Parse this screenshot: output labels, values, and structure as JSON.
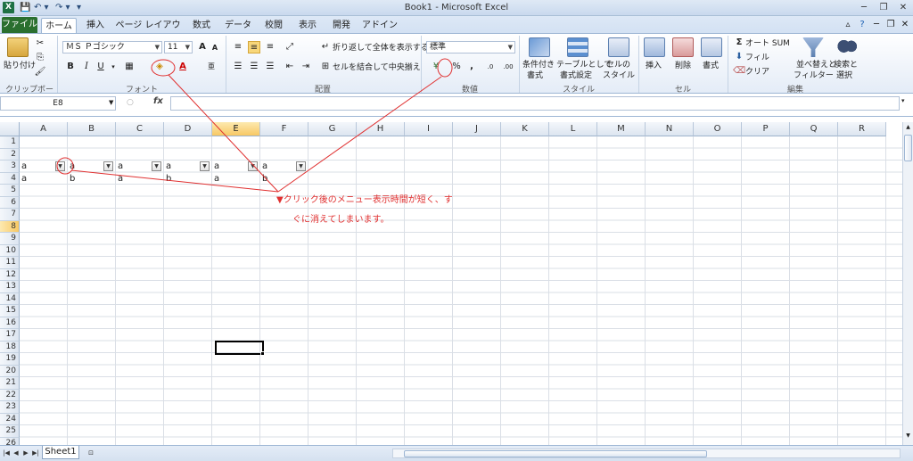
{
  "titlebar": {
    "title": "Book1 - Microsoft Excel",
    "min": "─",
    "restore": "❐",
    "close": "✕"
  },
  "qat": {
    "save": "💾",
    "undo": "↶ ▾",
    "redo": "↷ ▾",
    "more": "▾"
  },
  "tabs": {
    "file": "ファイル",
    "home": "ホーム",
    "insert": "挿入",
    "page_layout": "ページ レイアウト",
    "formulas": "数式",
    "data": "データ",
    "review": "校閲",
    "view": "表示",
    "developer": "開発",
    "addins": "アドイン"
  },
  "ribbon": {
    "clipboard": {
      "paste": "貼り付け",
      "label": "クリップボード"
    },
    "font": {
      "name": "ＭＳ Ｐゴシック",
      "size": "11",
      "label": "フォント",
      "bold": "B",
      "italic": "I",
      "underline": "U"
    },
    "alignment": {
      "wrap": "折り返して全体を表示する",
      "merge": "セルを結合して中央揃え",
      "label": "配置"
    },
    "number": {
      "format": "標準",
      "percent": "%",
      "comma": ",",
      "label": "数値"
    },
    "styles": {
      "cond": "条件付き",
      "cond2": "書式",
      "table": "テーブルとして",
      "table2": "書式設定",
      "cell": "セルの",
      "cell2": "スタイル",
      "label": "スタイル"
    },
    "cells": {
      "insert": "挿入",
      "delete": "削除",
      "format": "書式",
      "label": "セル"
    },
    "editing": {
      "autosum": "オート SUM",
      "fill": "フィル",
      "clear": "クリア",
      "sort": "並べ替えと",
      "sort2": "フィルター",
      "find": "検索と",
      "find2": "選択",
      "label": "編集"
    }
  },
  "formula_bar": {
    "name_box": "E8",
    "fx": "fx",
    "value": ""
  },
  "grid": {
    "columns": [
      "A",
      "B",
      "C",
      "D",
      "E",
      "F",
      "G",
      "H",
      "I",
      "J",
      "K",
      "L",
      "M",
      "N",
      "O",
      "P",
      "Q",
      "R"
    ],
    "rows": [
      "1",
      "2",
      "3",
      "4",
      "5",
      "6",
      "7",
      "8",
      "9",
      "10",
      "11",
      "12",
      "13",
      "14",
      "15",
      "16",
      "17",
      "18",
      "19",
      "20",
      "21",
      "22",
      "23",
      "24",
      "25",
      "26"
    ],
    "selected_col": "E",
    "selected_row": "8",
    "row3": [
      "a",
      "a",
      "a",
      "a",
      "a",
      "a"
    ],
    "row4": [
      "a",
      "b",
      "a",
      "b",
      "a",
      "b"
    ]
  },
  "annotation": {
    "line1": "▼クリック後のメニュー表示時間が短く、す",
    "line2": "ぐに消えてしまいます。",
    "color": "#e03030"
  },
  "sheets": {
    "active": "Sheet1"
  }
}
